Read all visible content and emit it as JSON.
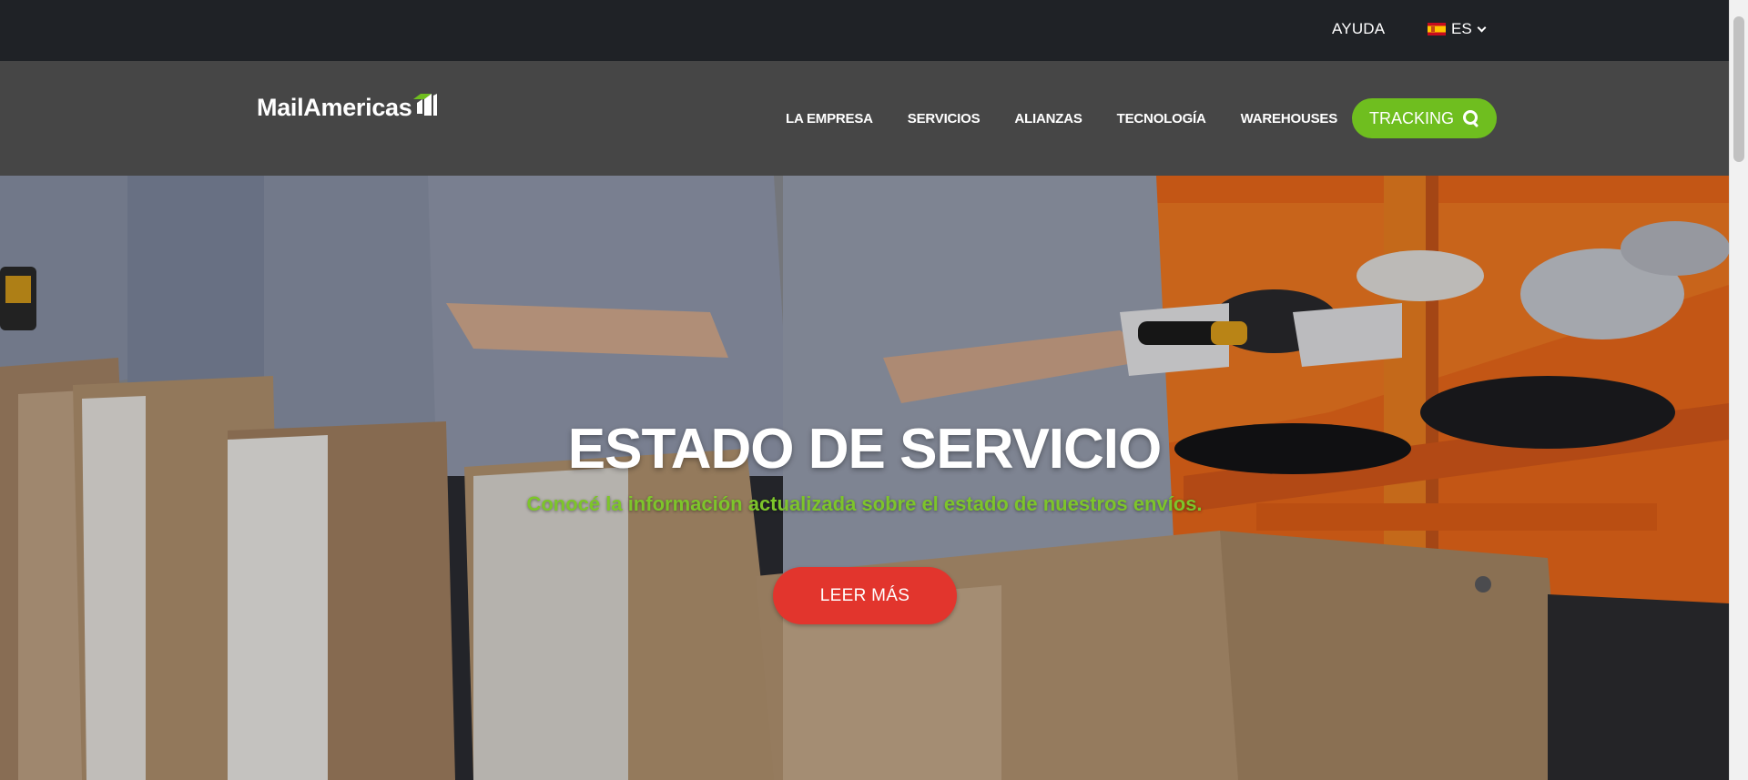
{
  "topbar": {
    "help_label": "AYUDA",
    "language": {
      "code": "ES",
      "flag_icon": "spain-flag-icon"
    }
  },
  "header": {
    "logo_text": "MailAmericas",
    "nav": [
      {
        "label": "LA EMPRESA"
      },
      {
        "label": "SERVICIOS"
      },
      {
        "label": "ALIANZAS"
      },
      {
        "label": "TECNOLOGÍA"
      },
      {
        "label": "WAREHOUSES"
      }
    ],
    "tracking_label": "TRACKING",
    "tracking_icon": "search-icon"
  },
  "hero": {
    "title": "ESTADO DE SERVICIO",
    "subtitle": "Conocé la información actualizada sobre el estado de nuestros envíos.",
    "button_label": "LEER MÁS"
  },
  "colors": {
    "topbar_bg": "#1f2226",
    "navbar_bg": "#464646",
    "brand_green": "#6fbe1f",
    "subtitle_green": "#7dc52a",
    "cta_red": "#e2352d",
    "conveyor_orange": "#ee6a1a"
  }
}
